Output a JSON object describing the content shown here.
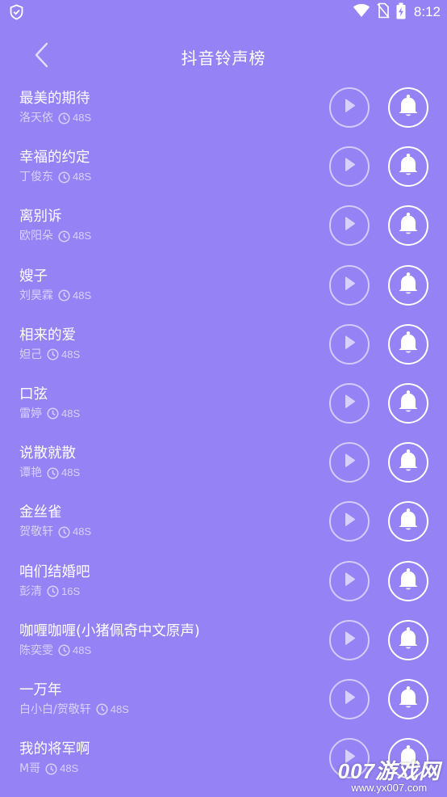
{
  "status_bar": {
    "time": "8:12",
    "icons": [
      "shield-check-icon",
      "wifi-icon",
      "no-sim-icon",
      "battery-charging-icon"
    ]
  },
  "header": {
    "title": "抖音铃声榜",
    "back_icon": "chevron-left-icon"
  },
  "songs": [
    {
      "title": "最美的期待",
      "artist": "洛天依",
      "duration": "48S"
    },
    {
      "title": "幸福的约定",
      "artist": "丁俊东",
      "duration": "48S"
    },
    {
      "title": "离别诉",
      "artist": "欧阳朵",
      "duration": "48S"
    },
    {
      "title": "嫂子",
      "artist": "刘昊霖",
      "duration": "48S"
    },
    {
      "title": "相来的爱",
      "artist": "妲己",
      "duration": "48S"
    },
    {
      "title": "口弦",
      "artist": "雷婷",
      "duration": "48S"
    },
    {
      "title": "说散就散",
      "artist": "谭艳",
      "duration": "48S"
    },
    {
      "title": "金丝雀",
      "artist": "贺敬轩",
      "duration": "48S"
    },
    {
      "title": "咱们结婚吧",
      "artist": "彭清",
      "duration": "16S"
    },
    {
      "title": "咖喱咖喱(小猪佩奇中文原声)",
      "artist": "陈奕雯",
      "duration": "48S"
    },
    {
      "title": "一万年",
      "artist": "白小白/贺敬轩",
      "duration": "48S"
    },
    {
      "title": "我的将军啊",
      "artist": "M哥",
      "duration": "48S"
    }
  ],
  "row_icons": {
    "play": "play-icon",
    "ring": "bell-icon",
    "duration": "clock-icon"
  },
  "watermark": {
    "logo": "007游戏网",
    "url": "www.yx007.com"
  },
  "colors": {
    "background": "#9583f6",
    "text": "#ffffff",
    "secondary_text": "rgba(255,255,255,0.62)"
  }
}
